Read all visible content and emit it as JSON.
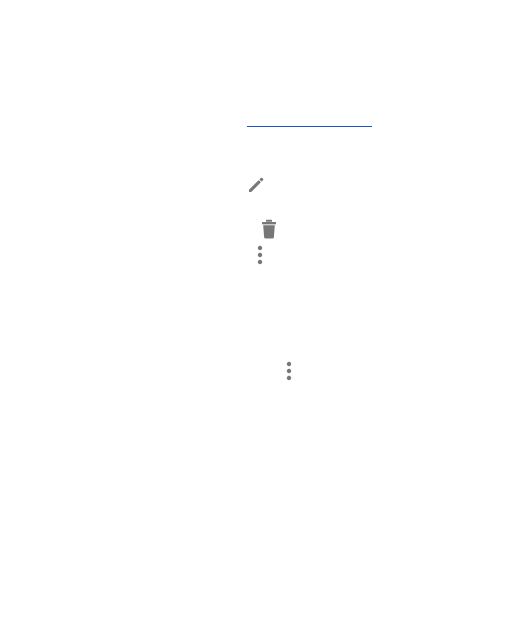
{
  "link": {
    "text": ""
  },
  "icons": {
    "edit": "pencil-icon",
    "delete": "trash-icon",
    "more_primary": "more-vertical-icon",
    "more_secondary": "more-vertical-icon"
  },
  "colors": {
    "icon": "#777777",
    "link_underline": "#1a55d6"
  }
}
